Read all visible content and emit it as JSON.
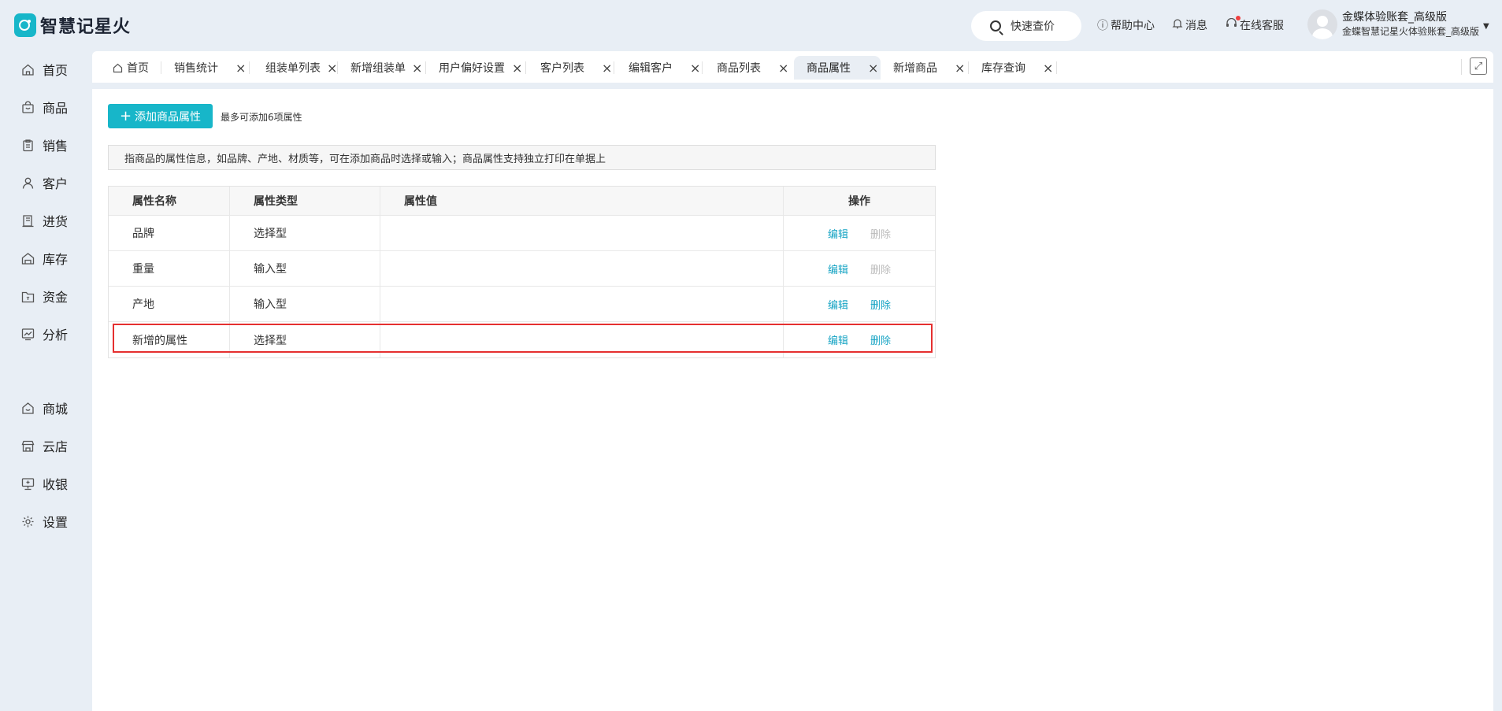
{
  "app": {
    "logo_text": "智慧记星火",
    "brand_color": "#17b6c9"
  },
  "header": {
    "quick_price": "快速查价",
    "help": "帮助中心",
    "messages": "消息",
    "support": "在线客服",
    "user_name": "金蝶体验账套_高级版",
    "user_sub": "金蝶智慧记星火体验账套_高级版"
  },
  "sidebar": {
    "items": [
      {
        "label": "首页",
        "icon": "home-icon"
      },
      {
        "label": "商品",
        "icon": "bag-icon"
      },
      {
        "label": "销售",
        "icon": "clipboard-icon"
      },
      {
        "label": "客户",
        "icon": "person-icon"
      },
      {
        "label": "进货",
        "icon": "purchase-icon"
      },
      {
        "label": "库存",
        "icon": "warehouse-icon"
      },
      {
        "label": "资金",
        "icon": "wallet-icon"
      },
      {
        "label": "分析",
        "icon": "chart-icon"
      },
      {
        "label": "商城",
        "icon": "mall-icon"
      },
      {
        "label": "云店",
        "icon": "store-icon"
      },
      {
        "label": "收银",
        "icon": "cashier-icon"
      },
      {
        "label": "设置",
        "icon": "gear-icon"
      }
    ]
  },
  "tabs": [
    {
      "label": "首页",
      "closable": false
    },
    {
      "label": "销售统计",
      "closable": true
    },
    {
      "label": "组装单列表",
      "closable": true
    },
    {
      "label": "新增组装单",
      "closable": true
    },
    {
      "label": "用户偏好设置",
      "closable": true
    },
    {
      "label": "客户列表",
      "closable": true
    },
    {
      "label": "编辑客户",
      "closable": true
    },
    {
      "label": "商品列表",
      "closable": true
    },
    {
      "label": "商品属性",
      "closable": true,
      "active": true
    },
    {
      "label": "新增商品",
      "closable": true
    },
    {
      "label": "库存查询",
      "closable": true
    }
  ],
  "main": {
    "add_button": "添加商品属性",
    "hint": "最多可添加6项属性",
    "notice": "指商品的属性信息，如品牌、产地、材质等，可在添加商品时选择或输入；商品属性支持独立打印在单据上",
    "table": {
      "headers": [
        "属性名称",
        "属性类型",
        "属性值",
        "操作"
      ],
      "rows": [
        {
          "name": "品牌",
          "type": "选择型",
          "value": "",
          "edit": "编辑",
          "delete": "删除",
          "delete_enabled": false
        },
        {
          "name": "重量",
          "type": "输入型",
          "value": "",
          "edit": "编辑",
          "delete": "删除",
          "delete_enabled": false
        },
        {
          "name": "产地",
          "type": "输入型",
          "value": "",
          "edit": "编辑",
          "delete": "删除",
          "delete_enabled": true
        },
        {
          "name": "新增的属性",
          "type": "选择型",
          "value": "",
          "edit": "编辑",
          "delete": "删除",
          "delete_enabled": true
        }
      ]
    }
  }
}
